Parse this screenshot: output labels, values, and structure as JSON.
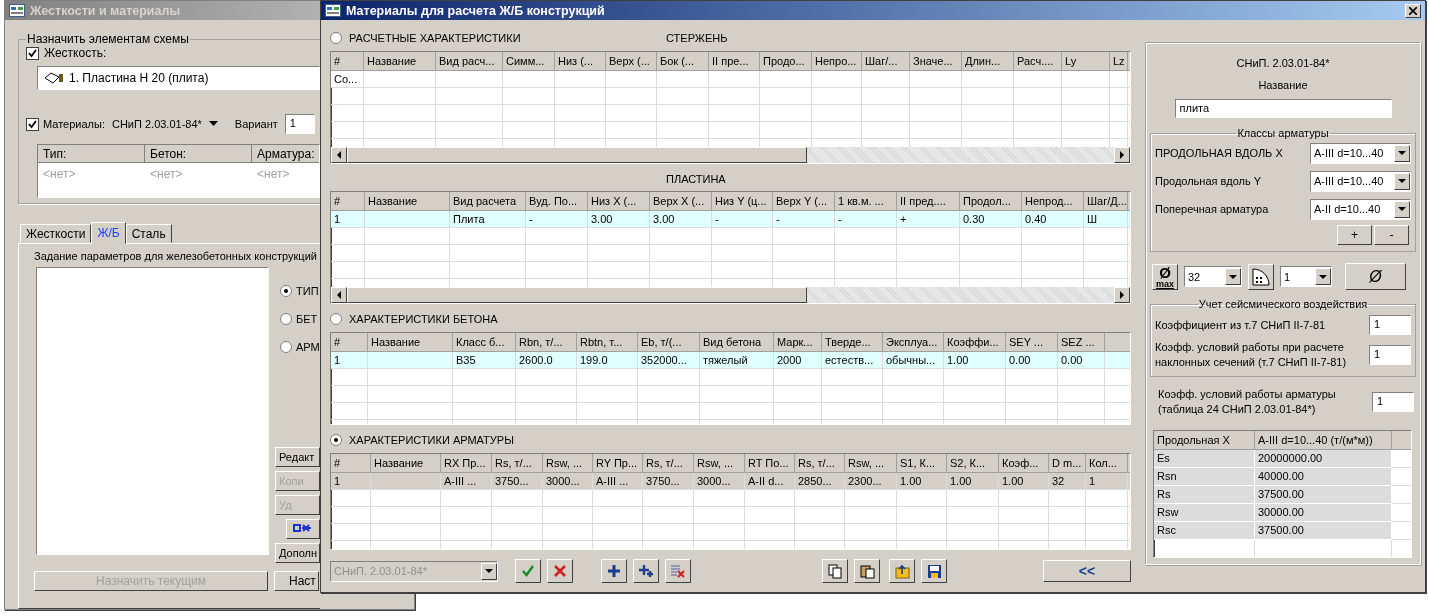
{
  "back_window": {
    "title": "Жесткости и материалы",
    "assign_group": {
      "title": "Назначить элементам схемы",
      "stiffness": {
        "label": "Жесткость:",
        "checked": true,
        "item": "1. Пластина  Н 20 (плита)"
      },
      "materials": {
        "label": "Материалы:",
        "checked": true,
        "norm": "СНиП 2.03.01-84*",
        "variant_label": "Вариант",
        "variant": "1"
      },
      "table": {
        "columns": [
          "Тип:",
          "Бетон:",
          "Арматура:"
        ],
        "rows": [
          [
            "<нет>",
            "<нет>",
            "<нет>"
          ]
        ]
      }
    },
    "tabs": [
      {
        "label": "Жесткости",
        "selected": false
      },
      {
        "label": "Ж/Б",
        "selected": true
      },
      {
        "label": "Сталь",
        "selected": false
      }
    ],
    "panel": {
      "caption": "Задание параметров для железобетонных конструкций",
      "radios": [
        {
          "label": "ТИП",
          "selected": true
        },
        {
          "label": "БЕТ",
          "selected": false
        },
        {
          "label": "АРМ",
          "selected": false
        }
      ],
      "buttons": [
        {
          "kind": "text",
          "label": "Редакт",
          "disabled": false
        },
        {
          "kind": "text",
          "label": "Копи",
          "disabled": true
        },
        {
          "kind": "text",
          "label": "Уд",
          "disabled": true
        },
        {
          "kind": "icon",
          "disabled": false
        },
        {
          "kind": "text",
          "label": "Дополн",
          "disabled": false
        }
      ],
      "assign_button": {
        "label": "Назначить текущим",
        "disabled": true
      },
      "settings_button": {
        "label": "Наст",
        "disabled": false
      }
    }
  },
  "dialog": {
    "title": "Материалы для расчета Ж/Б конструкций",
    "sections": [
      {
        "radio": {
          "label": "РАСЧЕТНЫЕ ХАРАКТЕРИСТИКИ",
          "selected": false
        },
        "heading": "СТЕРЖЕНЬ",
        "columns": [
          "#",
          "Название",
          "Вид расч...",
          "Симм...",
          "Низ (...",
          "Верх (...",
          "Бок (...",
          "II пре...",
          "Продо...",
          "Непро...",
          "Шаг/...",
          "Значе...",
          "Длин...",
          "Расч....",
          "Ly",
          "Lz"
        ],
        "rows": [
          {
            "cells": [
              "Со..."
            ],
            "selected": false
          }
        ]
      },
      {
        "heading": "ПЛАСТИНА",
        "columns": [
          "#",
          "Название",
          "Вид расчета",
          "Вуд. По...",
          "Низ X (...",
          "Верх X (...",
          "Низ Y (ц...",
          "Верх Y (...",
          "1 кв.м. ...",
          "II пред....",
          "Продол...",
          "Непрод...",
          "Шаг/Д..."
        ],
        "rows": [
          {
            "cells": [
              "1",
              null,
              "Плита",
              "-",
              "3.00",
              "3.00",
              "-",
              "-",
              "-",
              "+",
              "0.30",
              "0.40",
              "Ш"
            ],
            "selected": true
          }
        ]
      },
      {
        "radio": {
          "label": "ХАРАКТЕРИСТИКИ БЕТОНА",
          "selected": false
        },
        "columns": [
          "#",
          "Название",
          "Класс б...",
          "Rbn, т/...",
          "Rbtn, т...",
          "Eb, т/(...",
          "Вид бетона",
          "Марк...",
          "Тверде...",
          "Эксплуа...",
          "Коэффи...",
          "SEY ...",
          "SEZ ..."
        ],
        "rows": [
          {
            "cells": [
              "1",
              null,
              "В35",
              "2600.0",
              "199.0",
              "352000...",
              "тяжелый",
              "2000",
              "естеств...",
              "обычны...",
              "1.00",
              "0.00",
              "0.00"
            ],
            "selected": true
          }
        ]
      },
      {
        "radio": {
          "label": "ХАРАКТЕРИСТИКИ АРМАТУРЫ",
          "selected": true
        },
        "columns": [
          "#",
          "Название",
          "RX Пр...",
          "Rs, т/...",
          "Rsw, ...",
          "RY Пр...",
          "Rs, т/...",
          "Rsw, ...",
          "RT По...",
          "Rs, т/...",
          "Rsw, ...",
          "S1, К...",
          "S2, К...",
          "Коэф...",
          "D m...",
          "Кол..."
        ],
        "rows": [
          {
            "cells": [
              "1",
              null,
              "A-III ...",
              "3750...",
              "3000...",
              "A-III ...",
              "3750...",
              "3000...",
              "A-II d...",
              "2850...",
              "2300...",
              "1.00",
              "1.00",
              "1.00",
              "32",
              "1"
            ],
            "selected": true
          }
        ]
      }
    ],
    "toolbar": {
      "norm_select": {
        "value": "СНиП. 2.03.01-84*",
        "disabled": true
      },
      "tool_groups": [
        [
          {
            "kind": "confirm"
          },
          {
            "kind": "cancel"
          }
        ],
        [
          {
            "kind": "add"
          },
          {
            "kind": "add-copy"
          },
          {
            "kind": "delete"
          }
        ],
        [
          {
            "kind": "copy"
          },
          {
            "kind": "paste"
          }
        ],
        [
          {
            "kind": "import"
          },
          {
            "kind": "save"
          }
        ]
      ],
      "collapse_button": "<<"
    },
    "side": {
      "norm": "СНиП. 2.03.01-84*",
      "name_label": "Название",
      "name_value": "плита",
      "classes": {
        "title": "Классы арматуры",
        "rows": [
          {
            "label": "ПРОДОЛЬНАЯ ВДОЛЬ X",
            "value": "A-III d=10...40"
          },
          {
            "label": "Продольная вдоль Y",
            "value": "A-III d=10...40"
          },
          {
            "label": "Поперечная арматура",
            "value": "A-II d=10...40"
          }
        ],
        "add": "+",
        "remove": "-"
      },
      "diameter": {
        "symbol": "Ø",
        "sub": "max",
        "value": "32",
        "layers_value": "1",
        "button": "Ø"
      },
      "seismic": {
        "title": "Учет сейсмического  воздействия",
        "rows": [
          {
            "label": "Коэффициент из т.7 СНиП II-7-81",
            "value": "1"
          },
          {
            "label": "Коэфф. условий работы при расчете наклонных сечений (т.7 СНиП II-7-81)",
            "value": "1"
          }
        ]
      },
      "rebar_coef": {
        "label": "Коэфф. условий работы арматуры (таблица 24 СНиП 2.03.01-84*)",
        "value": "1"
      },
      "table": {
        "columns": [
          "Продольная  X",
          "A-III d=10...40 (т/(м*м))"
        ],
        "rows": [
          [
            "Es",
            "20000000.00"
          ],
          [
            "Rsn",
            "40000.00"
          ],
          [
            "Rs",
            "37500.00"
          ],
          [
            "Rsw",
            "30000.00"
          ],
          [
            "Rsc",
            "37500.00"
          ]
        ]
      }
    }
  }
}
